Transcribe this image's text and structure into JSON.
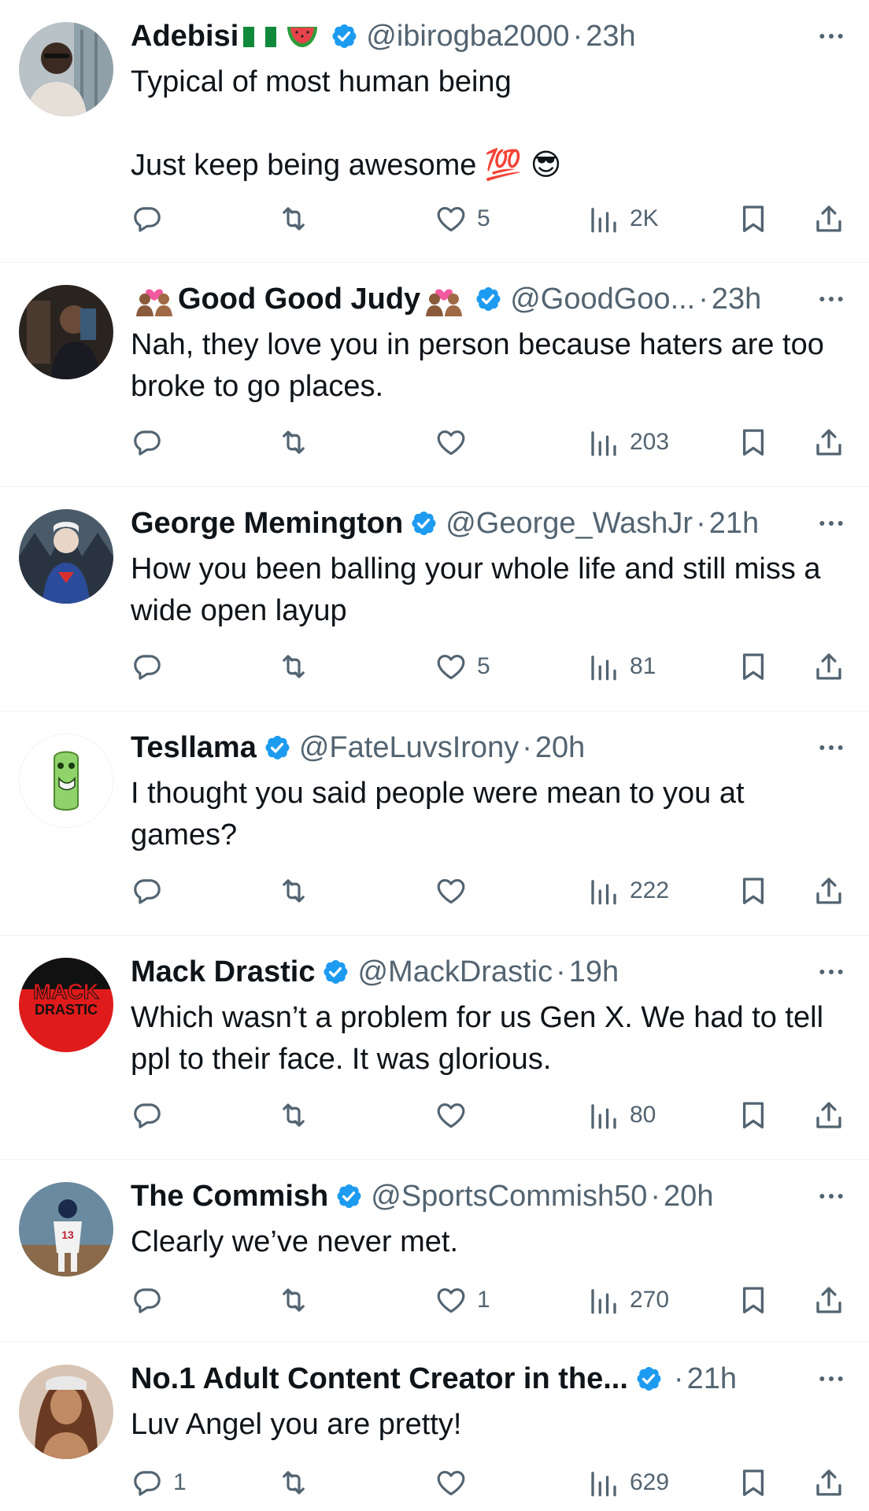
{
  "colors": {
    "verified": "#1d9bf0",
    "secondary": "#536471",
    "divider": "#eff3f4"
  },
  "tweets": [
    {
      "name": "Adebisi",
      "name_emojis": [
        "nigeria-flag",
        "watermelon"
      ],
      "handle": "@ibirogba2000",
      "separator": "·",
      "time": "23h",
      "text": "Typical of most human being\n\nJust keep being awesome 💯 😎",
      "reply_count": "",
      "like_count": "5",
      "views": "2K"
    },
    {
      "name": "Good Good Judy",
      "name_emojis": [
        "couple-with-heart",
        "couple-with-heart"
      ],
      "handle": "@GoodGoo...",
      "separator": "·",
      "time": "23h",
      "text": "Nah, they love you in person because haters are too broke to go places.",
      "reply_count": "",
      "like_count": "",
      "views": "203"
    },
    {
      "name": "George Memington",
      "handle": "@George_WashJr",
      "separator": "·",
      "time": "21h",
      "text": "How you been balling your whole life and still miss a wide open layup",
      "reply_count": "",
      "like_count": "5",
      "views": "81"
    },
    {
      "name": "Tesllama",
      "handle": "@FateLuvsIrony",
      "separator": "·",
      "time": "20h",
      "text": "I thought you said people were mean to you at games?",
      "reply_count": "",
      "like_count": "",
      "views": "222"
    },
    {
      "name": "Mack Drastic",
      "avatar_text": [
        "MACK",
        "DRASTIC"
      ],
      "handle": "@MackDrastic",
      "separator": "·",
      "time": "19h",
      "text": "Which wasn’t a problem for us Gen X. We had to tell ppl to their face. It was glorious.",
      "reply_count": "",
      "like_count": "",
      "views": "80"
    },
    {
      "name": "The Commish",
      "handle": "@SportsCommish50",
      "separator": "·",
      "time": "20h",
      "text": "Clearly we’ve never met.",
      "reply_count": "",
      "like_count": "1",
      "views": "270"
    },
    {
      "name": "No.1 Adult Content Creator in the...",
      "handle": "",
      "separator": "·",
      "time": "21h",
      "text": "Luv Angel you are pretty!",
      "reply_count": "1",
      "like_count": "",
      "views": "629"
    }
  ],
  "icons": {
    "reply": "reply-icon",
    "retweet": "retweet-icon",
    "like": "heart-icon",
    "views": "views-icon",
    "bookmark": "bookmark-icon",
    "share": "share-icon",
    "more": "more-icon",
    "verified": "verified-badge-icon"
  }
}
